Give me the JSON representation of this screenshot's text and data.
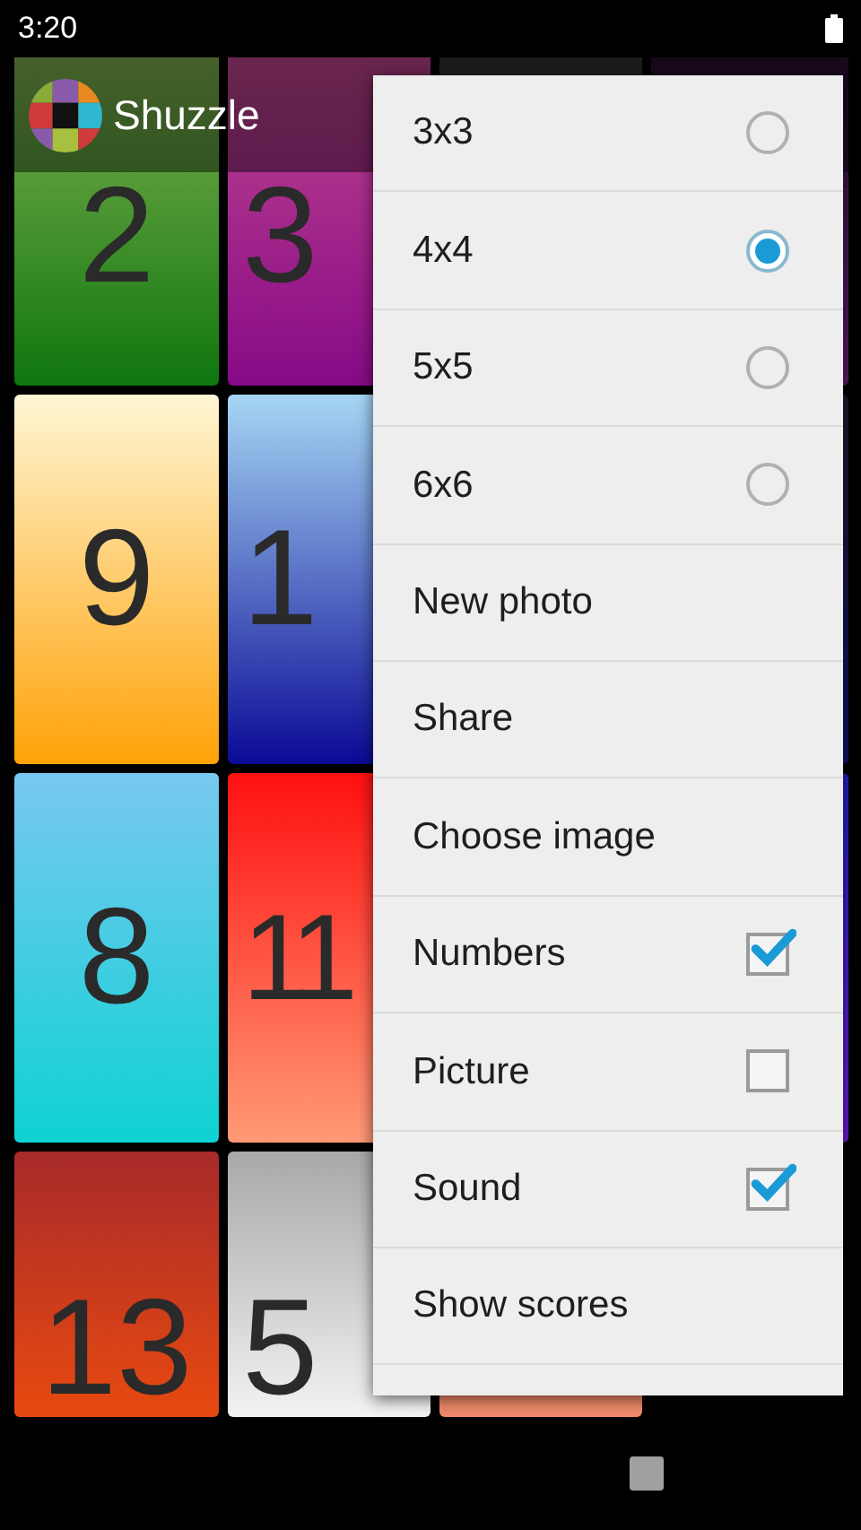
{
  "status_bar": {
    "time": "3:20"
  },
  "app_bar": {
    "title": "Shuzzle"
  },
  "tile_rows": [
    [
      "2",
      "3"
    ],
    [
      "9",
      "1"
    ],
    [
      "8",
      "11"
    ],
    [
      "13",
      "5"
    ]
  ],
  "menu": {
    "items": [
      {
        "label": "3x3",
        "kind": "radio",
        "selected": false
      },
      {
        "label": "4x4",
        "kind": "radio",
        "selected": true
      },
      {
        "label": "5x5",
        "kind": "radio",
        "selected": false
      },
      {
        "label": "6x6",
        "kind": "radio",
        "selected": false
      },
      {
        "label": "New photo",
        "kind": "action"
      },
      {
        "label": "Share",
        "kind": "action"
      },
      {
        "label": "Choose image",
        "kind": "action"
      },
      {
        "label": "Numbers",
        "kind": "check",
        "checked": true
      },
      {
        "label": "Picture",
        "kind": "check",
        "checked": false
      },
      {
        "label": "Sound",
        "kind": "check",
        "checked": true
      },
      {
        "label": "Show scores",
        "kind": "action"
      }
    ]
  }
}
